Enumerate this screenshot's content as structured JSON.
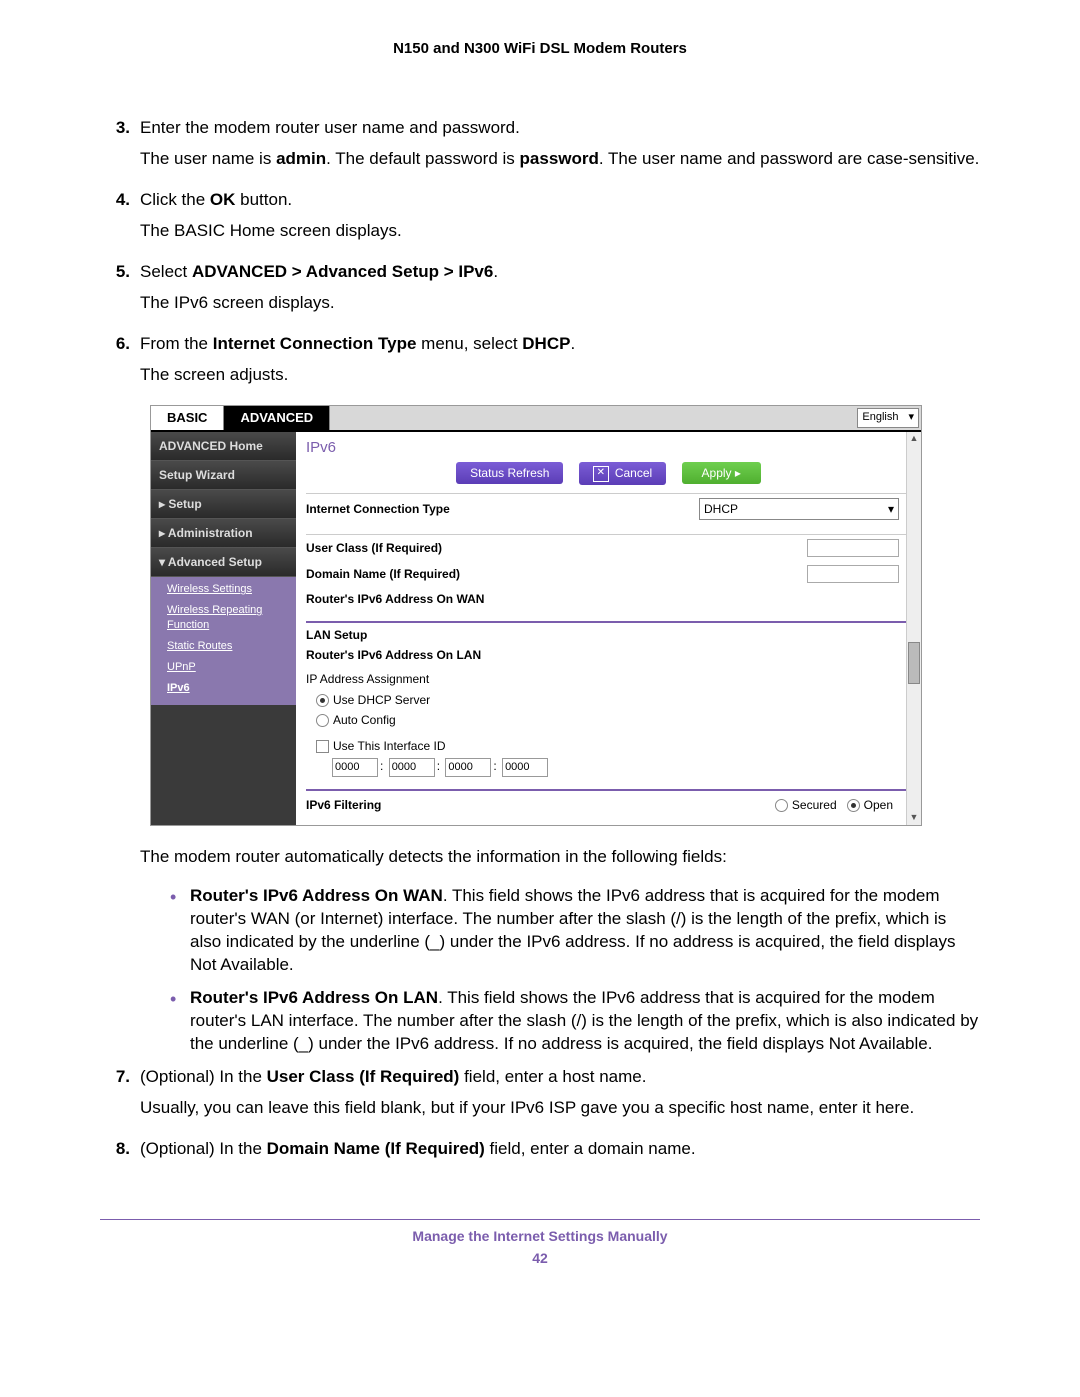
{
  "doc": {
    "header": "N150 and N300 WiFi DSL Modem Routers",
    "footer_title": "Manage the Internet Settings Manually",
    "page_number": "42"
  },
  "steps": {
    "s3": {
      "num": "3.",
      "line1": "Enter the modem router user name and password.",
      "line2a": "The user name is ",
      "line2b": "admin",
      "line2c": ". The default password is ",
      "line2d": "password",
      "line2e": ". The user name and password are case-sensitive."
    },
    "s4": {
      "num": "4.",
      "line1a": "Click the ",
      "line1b": "OK",
      "line1c": " button.",
      "line2": "The BASIC Home screen displays."
    },
    "s5": {
      "num": "5.",
      "line1a": "Select ",
      "line1b": "ADVANCED > Advanced Setup > IPv6",
      "line1c": ".",
      "line2": "The IPv6 screen displays."
    },
    "s6": {
      "num": "6.",
      "line1a": "From the ",
      "line1b": "Internet Connection Type",
      "line1c": " menu, select ",
      "line1d": "DHCP",
      "line1e": ".",
      "line2": "The screen adjusts."
    },
    "after_shot": "The modem router automatically detects the information in the following fields:",
    "bullets": {
      "b1": {
        "lead": "Router's IPv6 Address On WAN",
        "rest": ". This field shows the IPv6 address that is acquired for the modem router's WAN (or Internet) interface. The number after the slash (/) is the length of the prefix, which is also indicated by the underline (_) under the IPv6 address. If no address is acquired, the field displays Not Available."
      },
      "b2": {
        "lead": "Router's IPv6 Address On LAN",
        "rest": ". This field shows the IPv6 address that is acquired for the modem router's LAN interface. The number after the slash (/) is the length of the prefix, which is also indicated by the underline (_) under the IPv6 address. If no address is acquired, the field displays Not Available."
      }
    },
    "s7": {
      "num": "7.",
      "line1a": "(Optional) In the ",
      "line1b": "User Class (If Required)",
      "line1c": " field, enter a host name.",
      "line2": "Usually, you can leave this field blank, but if your IPv6 ISP gave you a specific host name, enter it here."
    },
    "s8": {
      "num": "8.",
      "line1a": "(Optional) In the ",
      "line1b": "Domain Name (If Required)",
      "line1c": " field, enter a domain name."
    }
  },
  "ui": {
    "tabs": {
      "basic": "BASIC",
      "advanced": "ADVANCED"
    },
    "language": "English",
    "sidebar": {
      "home": "ADVANCED Home",
      "wizard": "Setup Wizard",
      "setup": "▸ Setup",
      "admin": "▸ Administration",
      "advsetup": "▾ Advanced Setup",
      "sub": {
        "wireless": "Wireless Settings",
        "repeating": "Wireless Repeating Function",
        "routes": "Static Routes",
        "upnp": "UPnP",
        "ipv6": "IPv6"
      }
    },
    "content": {
      "title": "IPv6",
      "btn_refresh": "Status Refresh",
      "btn_cancel": "Cancel",
      "btn_cancel_x": "✕",
      "btn_apply": "Apply    ▸",
      "conn_type_label": "Internet Connection Type",
      "conn_type_value": "DHCP",
      "user_class": "User Class (If Required)",
      "domain_name": "Domain Name (If Required)",
      "wan_addr": "Router's IPv6 Address On WAN",
      "lan_setup": "LAN Setup",
      "lan_addr": "Router's IPv6 Address On LAN",
      "ip_assign": "IP Address Assignment",
      "use_dhcp": "Use DHCP Server",
      "auto_config": "Auto Config",
      "use_iface": "Use This Interface ID",
      "iface_id": [
        "0000",
        "0000",
        "0000",
        "0000"
      ],
      "filtering": "IPv6 Filtering",
      "secured": "Secured",
      "open": "Open"
    }
  }
}
